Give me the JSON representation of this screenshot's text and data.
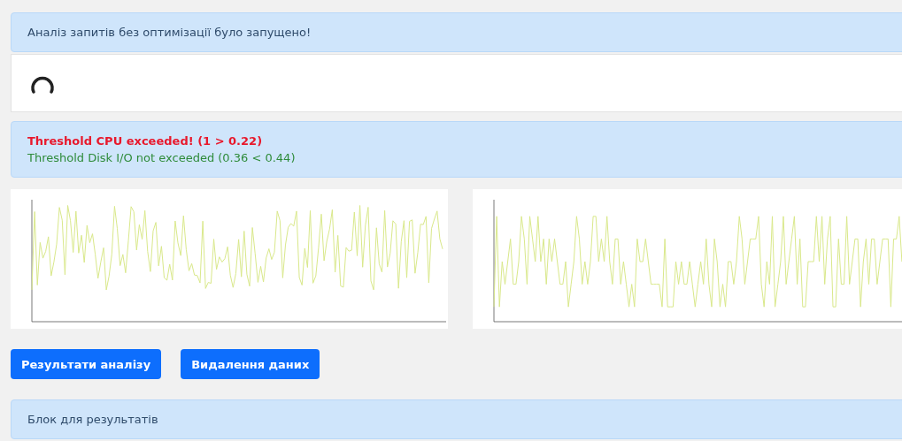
{
  "status_alert": {
    "text": "Аналіз запитів без оптимізації було запущено!"
  },
  "loader": {
    "loading": true
  },
  "thresholds": [
    {
      "text": "Threshold CPU exceeded! (1 > 0.22)",
      "exceeded": true
    },
    {
      "text": "Threshold Disk I/O not exceeded (0.36 < 0.44)",
      "exceeded": false
    }
  ],
  "charts": [
    {
      "kind": "spiky"
    },
    {
      "kind": "stepped"
    }
  ],
  "buttons": [
    "Результати аналізу",
    "Видалення даних"
  ],
  "results_block": {
    "text": "Блок для результатів"
  }
}
